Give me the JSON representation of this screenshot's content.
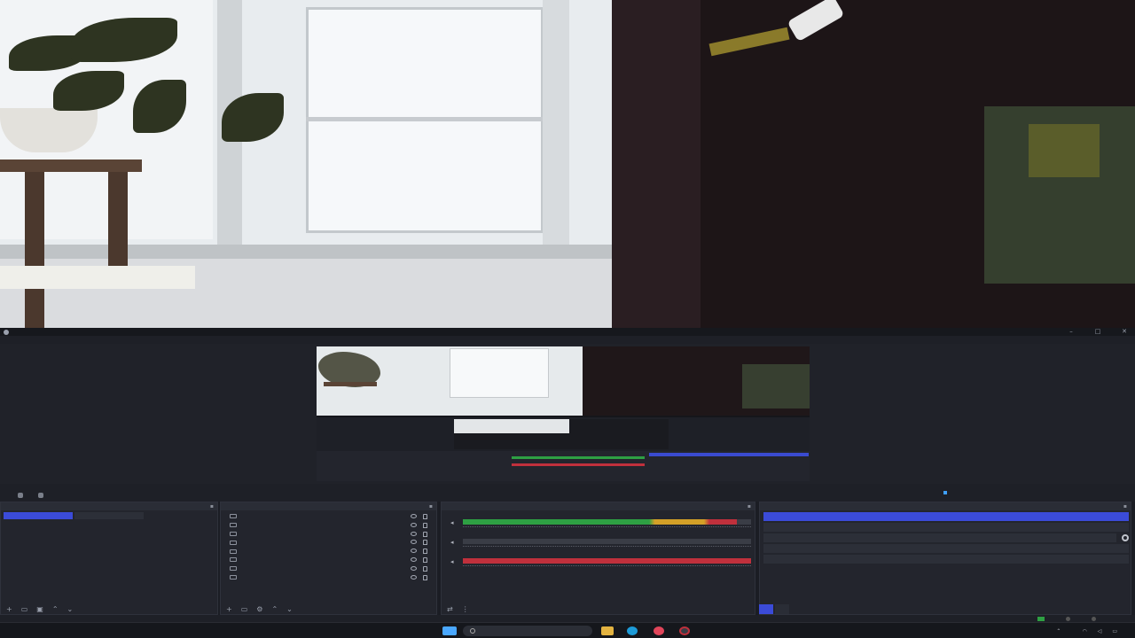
{
  "window": {
    "title": "",
    "controls": [
      "–",
      "□",
      "✕"
    ]
  },
  "menu": {
    "items": [
      "",
      "",
      "",
      "",
      "",
      "",
      "",
      ""
    ]
  },
  "dock_tabs": {
    "active_source": "",
    "properties": "",
    "filters": ""
  },
  "scenes": {
    "title": "",
    "items": [
      "",
      ""
    ],
    "active_index": 0
  },
  "sources": {
    "title": "",
    "items": [
      {
        "name": "",
        "icon": "monitor-icon"
      },
      {
        "name": "",
        "icon": "image-icon"
      },
      {
        "name": "",
        "icon": "window-icon"
      },
      {
        "name": "",
        "icon": "audio-icon"
      },
      {
        "name": "",
        "icon": "audio-icon"
      },
      {
        "name": "",
        "icon": "folder-icon"
      },
      {
        "name": "",
        "icon": "camera-icon"
      },
      {
        "name": "",
        "icon": "window-icon"
      }
    ]
  },
  "mixer": {
    "title": "",
    "channels": [
      {
        "name": "",
        "db": "",
        "level": 0.95,
        "color": "#2ea043"
      },
      {
        "name": "",
        "db": "",
        "level": 0.0,
        "color": "#2ea043"
      },
      {
        "name": "",
        "db": "",
        "level": 1.0,
        "color": "#c0303c"
      }
    ]
  },
  "controls": {
    "title": "",
    "start_streaming": "",
    "start_recording": "",
    "start_virtual_camera": "",
    "studio_mode": "",
    "settings": ""
  },
  "bottom_tabs": {
    "controls": "",
    "transitions": ""
  },
  "status": {
    "dropped": "",
    "bitrate": "",
    "stream_time": "",
    "rec_time": "",
    "cpu": "",
    "fps": ""
  },
  "taskbar": {
    "search": "",
    "lang": "",
    "time": "",
    "date": ""
  },
  "colors": {
    "accent": "#3b4bd8",
    "meter_green": "#2ea043",
    "meter_yellow": "#d4a027",
    "meter_red": "#c0303c"
  }
}
